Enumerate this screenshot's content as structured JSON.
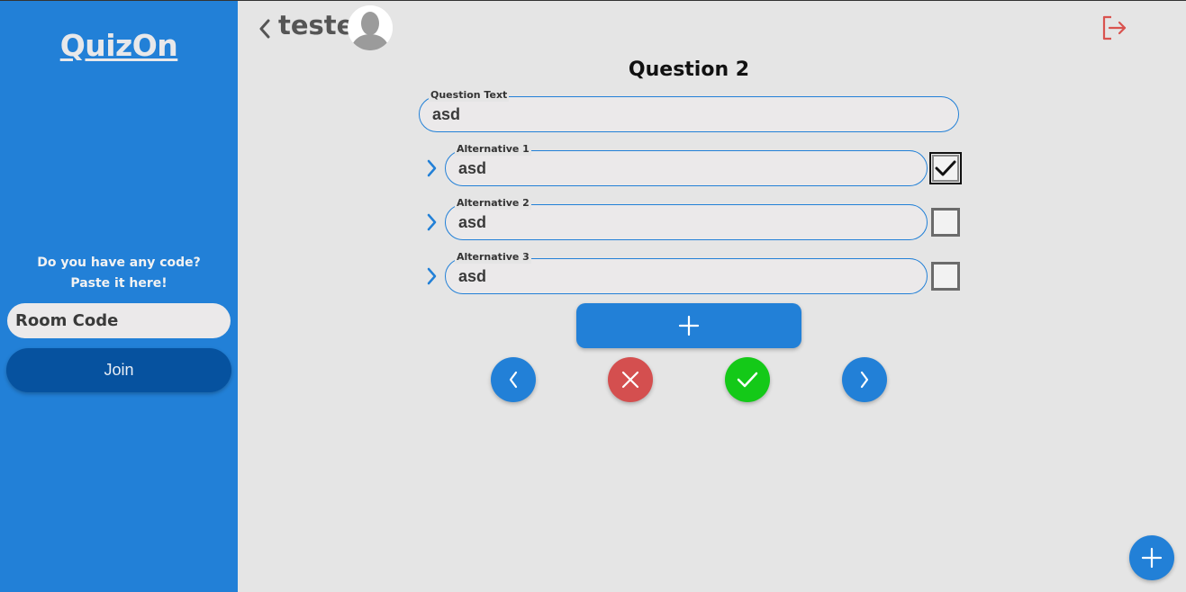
{
  "sidebar": {
    "brand": "QuizOn",
    "code_prompt_line1": "Do you have any code?",
    "code_prompt_line2": "Paste it here!",
    "room_code_placeholder": "Room Code",
    "join_label": "Join",
    "colors": {
      "background": "#2280d7",
      "join_button": "#06529f"
    }
  },
  "header": {
    "user_name": "teste",
    "icons": [
      "chevron-left-icon",
      "avatar",
      "logout-icon"
    ],
    "logout_color": "#d9534f"
  },
  "editor": {
    "question_title": "Question 2",
    "question_text": {
      "label": "Question Text",
      "value": "asd"
    },
    "alternatives": [
      {
        "label": "Alternative 1",
        "value": "asd",
        "correct": true
      },
      {
        "label": "Alternative 2",
        "value": "asd",
        "correct": false
      },
      {
        "label": "Alternative 3",
        "value": "asd",
        "correct": false
      }
    ],
    "add_alternative_icon": "plus-icon",
    "actions": [
      {
        "name": "previous-question",
        "icon": "chevron-left-icon",
        "color": "#2280d7"
      },
      {
        "name": "delete-question",
        "icon": "close-icon",
        "color": "#d44f4f"
      },
      {
        "name": "save-question",
        "icon": "check-icon",
        "color": "#14c918"
      },
      {
        "name": "next-question",
        "icon": "chevron-right-icon",
        "color": "#2280d7"
      }
    ]
  },
  "fab": {
    "icon": "plus-icon",
    "color": "#2280d7"
  }
}
